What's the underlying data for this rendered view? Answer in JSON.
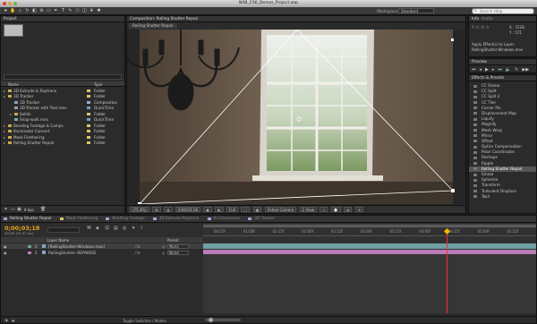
{
  "window": {
    "title": "NAB_CS6_Demos_Project.aep"
  },
  "toolbar": {
    "workspace_label": "Workspace:",
    "workspace_value": "Standard",
    "search_placeholder": "Search Help"
  },
  "project": {
    "tab": "Project",
    "columns": {
      "name": "Name",
      "type": "Type"
    },
    "items": [
      {
        "name": "3D Extrude & Raytrace",
        "type": "Folder",
        "color": "#d9c66a"
      },
      {
        "name": "3D Tracker",
        "type": "Folder",
        "color": "#d9c66a"
      },
      {
        "name": "3D Tracker",
        "type": "Composition",
        "color": "#9aa7d8"
      },
      {
        "name": "3D-Tracker with Text.mov",
        "type": "QuickTime",
        "color": "#6ea0c6"
      },
      {
        "name": "Solids",
        "type": "Folder",
        "color": "#d9c66a"
      },
      {
        "name": "Snap-walk.mov",
        "type": "QuickTime",
        "color": "#6ea0c6"
      },
      {
        "name": "Bending Footage & Comps",
        "type": "Folder",
        "color": "#d9c66a"
      },
      {
        "name": "Illuminator Convert",
        "type": "Folder",
        "color": "#d9c66a"
      },
      {
        "name": "Mask Feathering",
        "type": "Folder",
        "color": "#d9c66a"
      },
      {
        "name": "Rolling Shutter Repair",
        "type": "Folder",
        "color": "#d9c66a"
      }
    ],
    "bpc": "8 bpc"
  },
  "composition": {
    "tab": "Composition: Rolling Shutter Repair",
    "subtab": "Rolling Shutter Repair",
    "footer": {
      "zoom": "(75.4%)",
      "timecode": "0;00;03;18",
      "resolution": "Full",
      "camera": "Active Camera",
      "view": "1 View"
    }
  },
  "info": {
    "tabs": [
      "Info",
      "Audio"
    ],
    "x": "X : 1528",
    "y": "Y : 571",
    "lines": [
      "Apply Effect(s) to Layer:",
      "RollingShutter-Windows.mov"
    ]
  },
  "preview": {
    "tab": "Preview"
  },
  "effects": {
    "tab": "Effects & Presets",
    "items": [
      "CC Smear",
      "CC Split",
      "CC Split 2",
      "CC Tiler",
      "Corner Pin",
      "Displacement Map",
      "Liquify",
      "Magnify",
      "Mesh Warp",
      "Mirror",
      "Offset",
      "Optics Compensation",
      "Polar Coordinates",
      "Reshape",
      "Ripple",
      "Rolling Shutter Repair",
      "Smear",
      "Spherize",
      "Transform",
      "Turbulent Displace",
      "Twirl"
    ],
    "selected_index": 15
  },
  "timeline": {
    "tabs": [
      "Rolling Shutter Repair",
      "Mask Feathering",
      "Bending Footage",
      "3D Extrude-Raytrace",
      "Ai Conversion",
      "3D Tracker"
    ],
    "timecode": "0;00;03;18",
    "frame": "00108 (29.97 fps)",
    "columns": {
      "layer": "Layer Name",
      "parent": "Parent"
    },
    "layers": [
      {
        "num": "1",
        "name": "[RollingShutter-Windows.mov]",
        "parent": "None"
      },
      {
        "num": "2",
        "name": "RollingShutter--REPAIRED",
        "parent": "None"
      }
    ],
    "ruler": [
      "00:15f",
      "01:00f",
      "01:15f",
      "02:00f",
      "02:15f",
      "03:00f",
      "03:15f",
      "04:00f",
      "04:15f",
      "05:00f",
      "05:15f"
    ],
    "playhead_fraction": 0.73,
    "footer": "Toggle Switches / Modes"
  }
}
